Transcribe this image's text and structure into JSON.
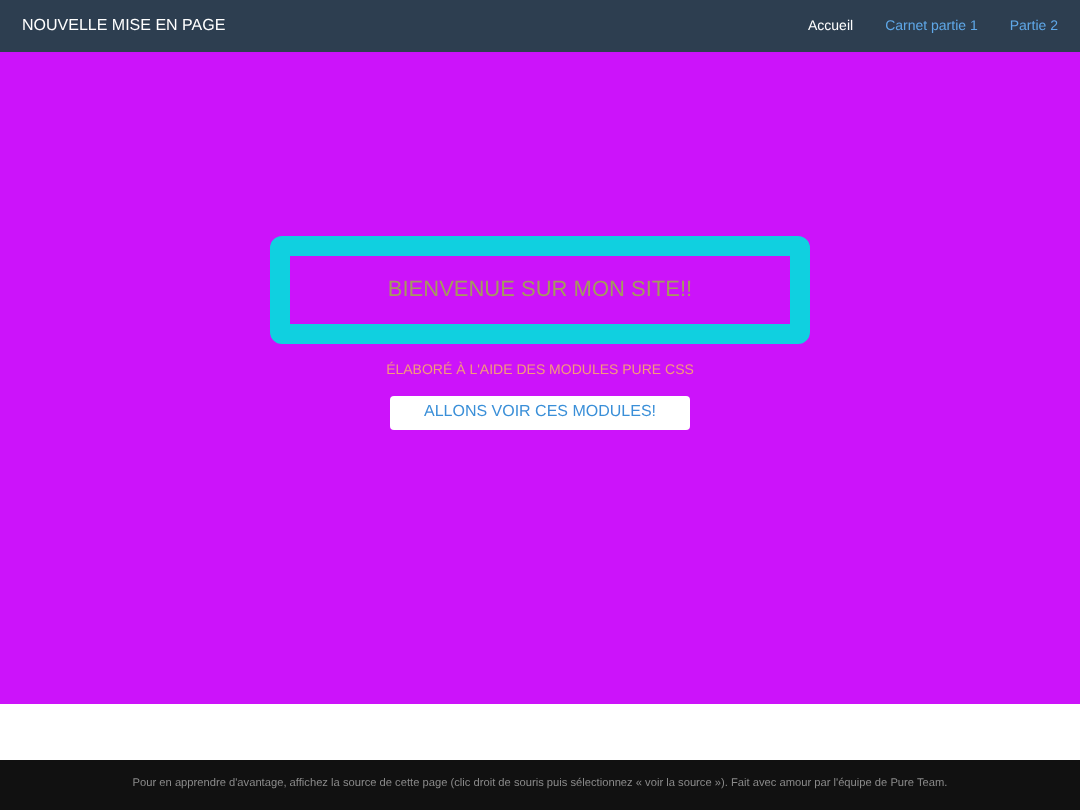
{
  "header": {
    "brand": "NOUVELLE MISE EN PAGE",
    "nav": [
      {
        "label": "Accueil",
        "selected": true
      },
      {
        "label": "Carnet partie 1",
        "selected": false
      },
      {
        "label": "Partie 2",
        "selected": false
      }
    ]
  },
  "hero": {
    "title": "BIENVENUE SUR MON SITE!!",
    "subtitle": "ÉLABORÉ À L'AIDE DES MODULES PURE CSS",
    "button": "ALLONS VOIR CES MODULES!"
  },
  "footer": {
    "text": "Pour en apprendre d'avantage, affichez la source de cette page (clic droit de souris puis sélectionnez « voir la source »). Fait avec amour par l'équipe de Pure Team."
  }
}
